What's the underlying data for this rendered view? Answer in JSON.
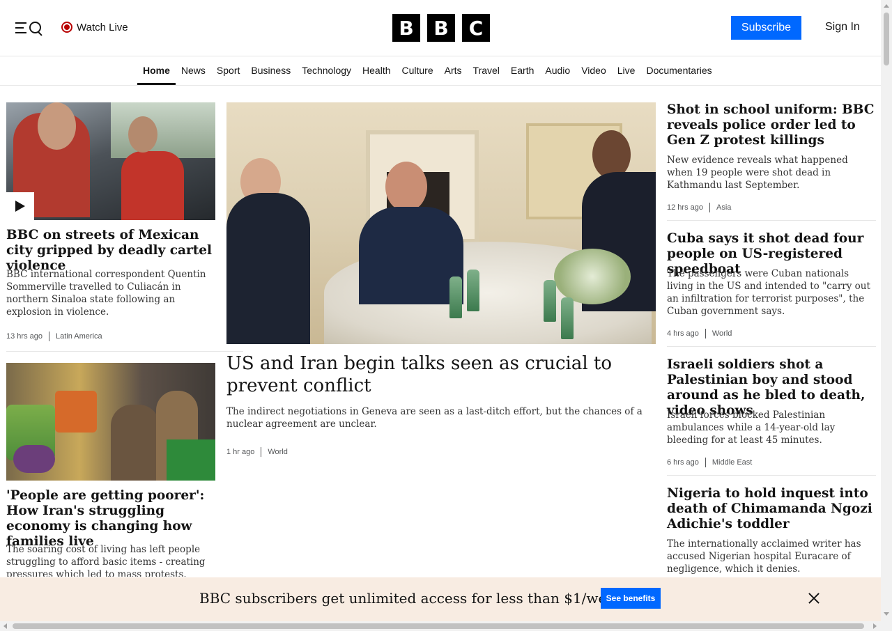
{
  "header": {
    "watch_live": "Watch Live",
    "logo_letters": [
      "B",
      "B",
      "C"
    ],
    "subscribe": "Subscribe",
    "sign_in": "Sign In"
  },
  "nav": [
    "Home",
    "News",
    "Sport",
    "Business",
    "Technology",
    "Health",
    "Culture",
    "Arts",
    "Travel",
    "Earth",
    "Audio",
    "Video",
    "Live",
    "Documentaries"
  ],
  "left": [
    {
      "headline": "BBC on streets of Mexican city gripped by deadly cartel violence",
      "summary": "BBC international correspondent Quentin Sommerville travelled to Culiacán in northern Sinaloa state following an explosion in violence.",
      "time": "13 hrs ago",
      "tag": "Latin America"
    },
    {
      "headline": "'People are getting poorer': How Iran's struggling economy is changing how families live",
      "summary": "The soaring cost of living has left people struggling to afford basic items - creating pressures which led to mass protests."
    }
  ],
  "main": {
    "headline": "US and Iran begin talks seen as crucial to prevent conflict",
    "summary": "The indirect negotiations in Geneva are seen as a last-ditch effort, but the chances of a nuclear agreement are unclear.",
    "time": "1 hr ago",
    "tag": "World"
  },
  "right": [
    {
      "headline": "Shot in school uniform: BBC reveals police order led to Gen Z protest killings",
      "summary": "New evidence reveals what happened when 19 people were shot dead in Kathmandu last September.",
      "time": "12 hrs ago",
      "tag": "Asia"
    },
    {
      "headline": "Cuba says it shot dead four people on US-registered speedboat",
      "summary": "The passengers were Cuban nationals living in the US and intended to \"carry out an infiltration for terrorist purposes\", the Cuban government says.",
      "time": "4 hrs ago",
      "tag": "World"
    },
    {
      "headline": "Israeli soldiers shot a Palestinian boy and stood around as he bled to death, video shows",
      "summary": "Israeli forces blocked Palestinian ambulances while a 14-year-old lay bleeding for at least 45 minutes.",
      "time": "6 hrs ago",
      "tag": "Middle East"
    },
    {
      "headline": "Nigeria to hold inquest into death of Chimamanda Ngozi Adichie's toddler",
      "summary": "The internationally acclaimed writer has accused Nigerian hospital Euracare of negligence, which it denies."
    }
  ],
  "banner": {
    "text": "BBC subscribers get unlimited access for less than $1/week",
    "button": "See benefits"
  },
  "colors": {
    "accent": "#0068ff",
    "live_red": "#b80000",
    "banner_bg": "#f8ece2"
  },
  "icons": [
    "menu-search-icon",
    "live-indicator-icon",
    "play-icon",
    "close-icon"
  ]
}
